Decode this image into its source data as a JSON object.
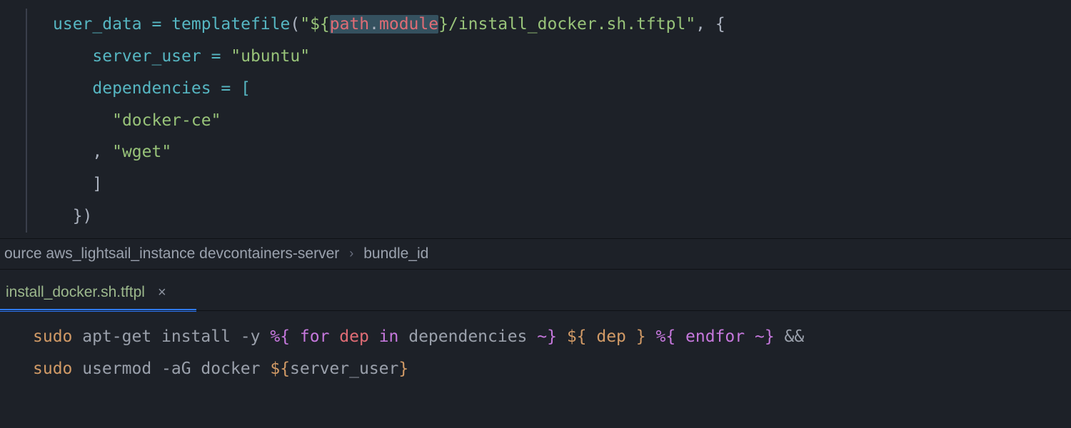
{
  "code_top": {
    "l1": {
      "assign": "user_data",
      "eq": " = ",
      "fn": "templatefile",
      "open": "(",
      "q1": "\"",
      "interp_open": "${",
      "path_word": "path",
      "dot": ".",
      "module_word": "module",
      "interp_close": "}",
      "path_rest": "/install_docker.sh.tftpl",
      "q2": "\"",
      "comma": ", {",
      "close_brace": ""
    },
    "l2": {
      "indent": "    ",
      "key": "server_user",
      "eq": " = ",
      "val": "\"ubuntu\""
    },
    "l3": {
      "indent": "    ",
      "key": "dependencies",
      "eq": " = [",
      "val": ""
    },
    "l4": {
      "indent": "      ",
      "val": "\"docker-ce\""
    },
    "l5": {
      "indent": "    , ",
      "val": "\"wget\""
    },
    "l6": {
      "indent": "    ",
      "val": "]"
    },
    "l7": {
      "indent": "  ",
      "val": "})"
    }
  },
  "breadcrumb": {
    "seg1": "ource aws_lightsail_instance devcontainers-server",
    "seg2": "bundle_id"
  },
  "tab": {
    "name": "install_docker.sh.tftpl",
    "close": "×"
  },
  "code_bottom": {
    "l1": {
      "sudo": "sudo",
      "apt": " apt-get install -y ",
      "pct1": "%{",
      "for": " for ",
      "dep1": "dep",
      "in": " in ",
      "deps": "dependencies",
      "tilde1": " ~",
      "close1": "} ",
      "dollar_open": "${",
      "dep2": " dep ",
      "dollar_close": "} ",
      "pct2": "%{",
      "endfor": " endfor ",
      "tilde2": "~",
      "close2": "} ",
      "andand": "&&"
    },
    "l2": {
      "sudo": "sudo",
      "usermod": " usermod -aG docker ",
      "dollar_open": "${",
      "var": "server_user",
      "dollar_close": "}"
    }
  }
}
